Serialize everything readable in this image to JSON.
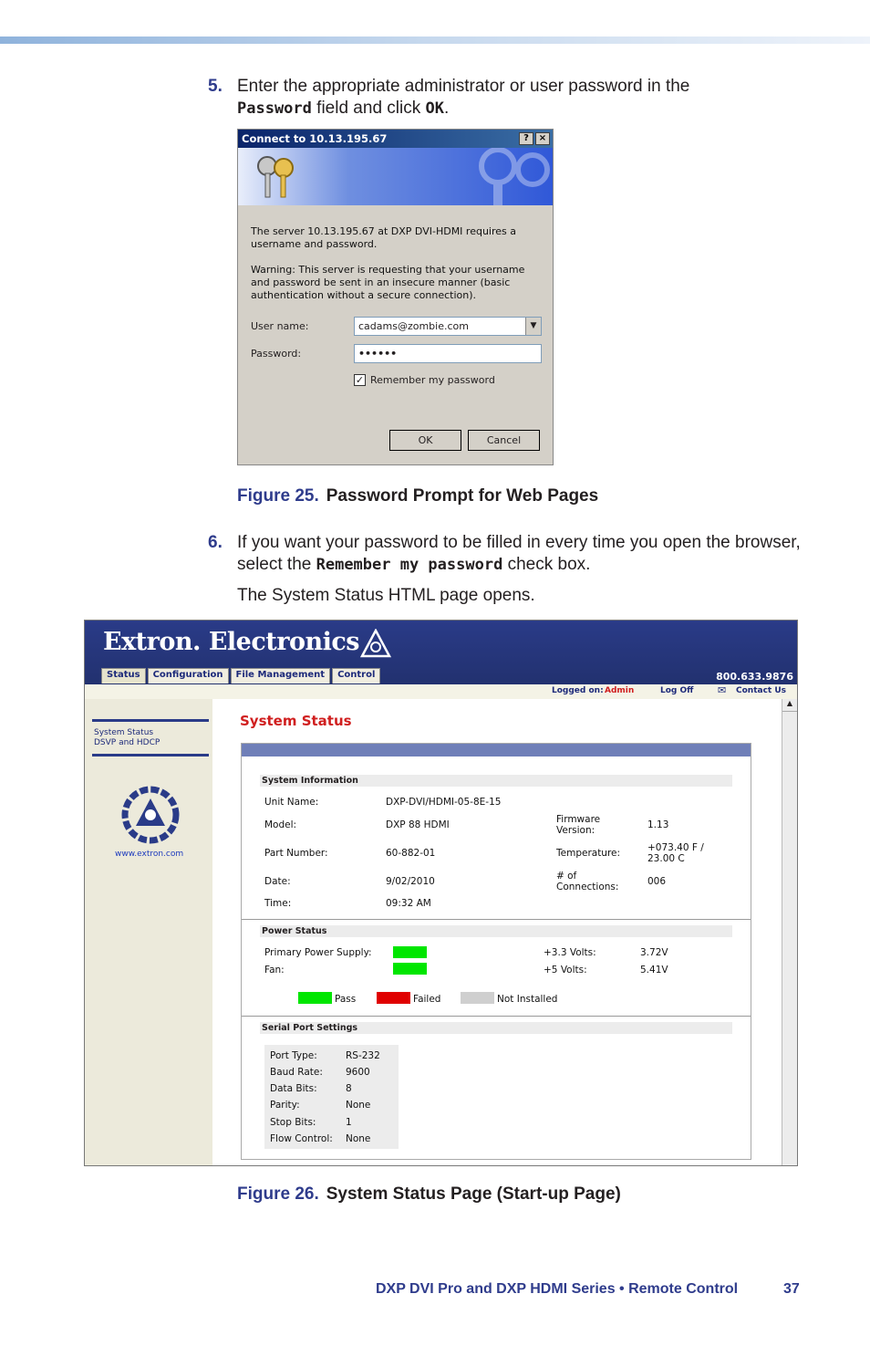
{
  "step5": {
    "num": "5.",
    "pre": "Enter the appropriate administrator or user password in the",
    "field": "Password",
    "mid": "field and click",
    "ok": "OK",
    "post": "."
  },
  "dialog": {
    "title": "Connect to 10.13.195.67",
    "help": "?",
    "close": "×",
    "text1": "The server 10.13.195.67 at DXP DVI-HDMI requires a username and password.",
    "text2": "Warning: This server is requesting that your username and password be sent in an insecure manner (basic authentication without a secure connection).",
    "user_label": "User name:",
    "user_value": "cadams@zombie.com",
    "pass_label": "Password:",
    "pass_value": "••••••",
    "remember": "Remember my password",
    "ok": "OK",
    "cancel": "Cancel"
  },
  "fig25": {
    "label": "Figure 25.",
    "title": "Password Prompt for Web Pages"
  },
  "step6": {
    "num": "6.",
    "pre": "If you want your password to be filled in every time you open the browser, select the",
    "field": "Remember my password",
    "post": "check box."
  },
  "opens": "The System Status HTML page opens.",
  "web": {
    "brand": "Extron. Electronics",
    "phone": "800.633.9876",
    "tabs": [
      "Status",
      "Configuration",
      "File Management",
      "Control"
    ],
    "logged_label": "Logged on:",
    "logged_user": "Admin",
    "logoff": "Log Off",
    "contact": "Contact Us",
    "nav1": "System Status",
    "nav2": "DSVP and HDCP",
    "site": "www.extron.com",
    "title": "System Status",
    "sys_info": "System Information",
    "unit_name_l": "Unit Name:",
    "unit_name_v": "DXP-DVI/HDMI-05-8E-15",
    "model_l": "Model:",
    "model_v": "DXP 88 HDMI",
    "fw_l": "Firmware Version:",
    "fw_v": "1.13",
    "part_l": "Part Number:",
    "part_v": "60-882-01",
    "temp_l": "Temperature:",
    "temp_v": "+073.40 F / 23.00 C",
    "date_l": "Date:",
    "date_v": "9/02/2010",
    "conn_l": "# of Connections:",
    "conn_v": "006",
    "time_l": "Time:",
    "time_v": "09:32 AM",
    "power": "Power Status",
    "pps_l": "Primary Power Supply:",
    "fan_l": "Fan:",
    "v33_l": "+3.3 Volts:",
    "v33_v": "3.72V",
    "v5_l": "+5 Volts:",
    "v5_v": "5.41V",
    "leg_pass": "Pass",
    "leg_fail": "Failed",
    "leg_ni": "Not Installed",
    "serial": "Serial Port Settings",
    "serial_rows": [
      [
        "Port Type:",
        "RS-232"
      ],
      [
        "Baud Rate:",
        "9600"
      ],
      [
        "Data Bits:",
        "8"
      ],
      [
        "Parity:",
        "None"
      ],
      [
        "Stop Bits:",
        "1"
      ],
      [
        "Flow Control:",
        "None"
      ]
    ],
    "colors": {
      "pass": "#00e600",
      "fail": "#e00000",
      "not_installed": "#cfcfcf"
    }
  },
  "fig26": {
    "label": "Figure 26.",
    "title": "System Status Page (Start-up Page)"
  },
  "footer": "DXP DVI Pro and DXP HDMI Series • Remote Control",
  "page": "37"
}
